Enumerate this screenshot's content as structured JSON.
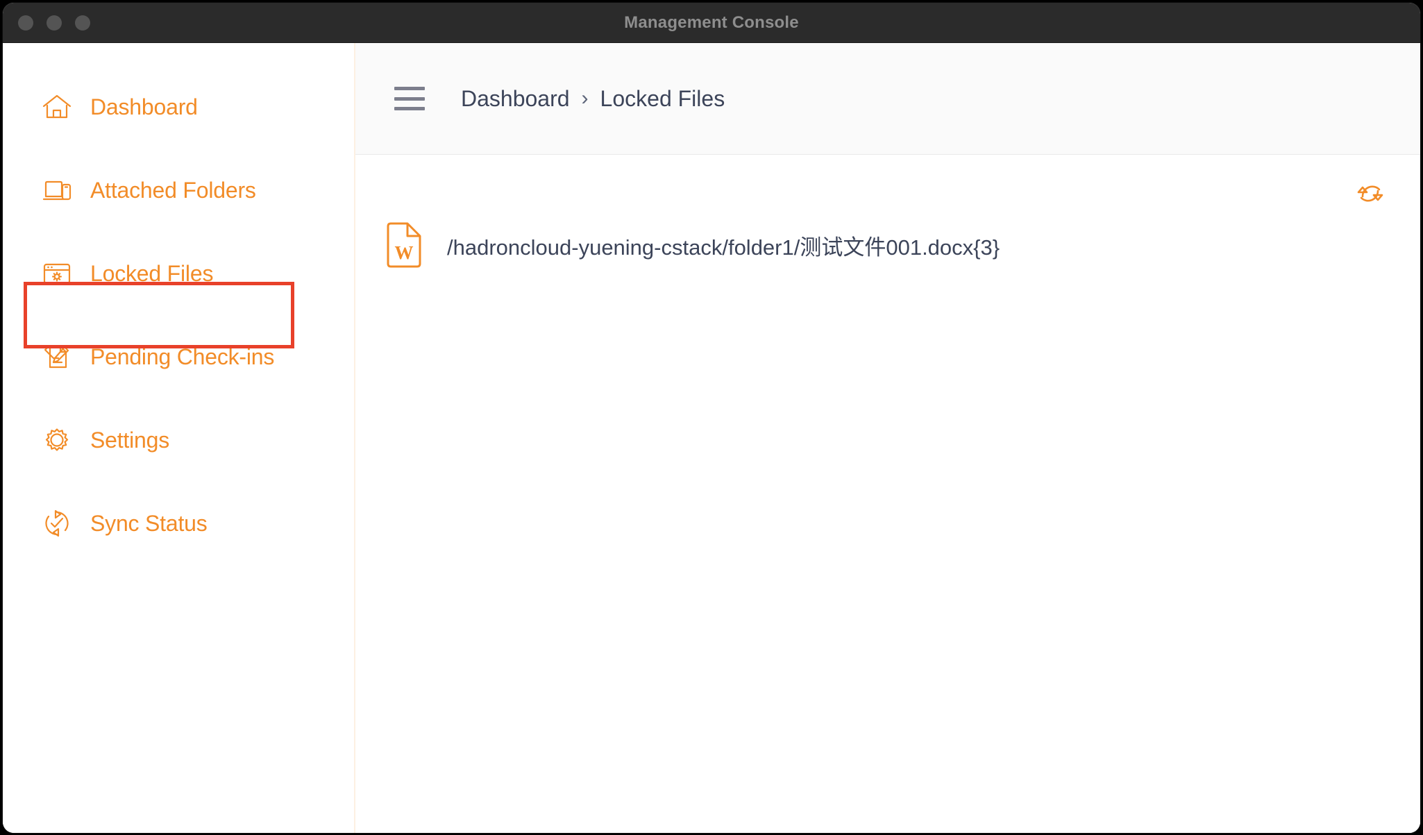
{
  "window": {
    "title": "Management Console",
    "traffic_lights": [
      "close",
      "minimize",
      "maximize"
    ]
  },
  "sidebar": {
    "items": [
      {
        "id": "dashboard",
        "label": "Dashboard",
        "icon": "home-icon",
        "active": false
      },
      {
        "id": "attached-folders",
        "label": "Attached Folders",
        "icon": "devices-icon",
        "active": false
      },
      {
        "id": "locked-files",
        "label": "Locked Files",
        "icon": "window-gear-icon",
        "active": true
      },
      {
        "id": "pending-checkins",
        "label": "Pending Check-ins",
        "icon": "document-pen-icon",
        "active": false
      },
      {
        "id": "settings",
        "label": "Settings",
        "icon": "gear-icon",
        "active": false
      },
      {
        "id": "sync-status",
        "label": "Sync Status",
        "icon": "sync-check-icon",
        "active": false
      }
    ]
  },
  "header": {
    "menu_icon": "hamburger-icon",
    "breadcrumb": {
      "root": "Dashboard",
      "separator": "›",
      "current": "Locked Files"
    }
  },
  "content": {
    "refresh_icon": "refresh-icon",
    "files": [
      {
        "icon": "word-document-icon",
        "icon_letter": "W",
        "path": "/hadroncloud-yuening-cstack/folder1/测试文件001.docx{3}"
      }
    ]
  },
  "colors": {
    "accent_orange": "#f28c28",
    "highlight_red": "#e8412a",
    "text_slate": "#3c4459",
    "titlebar_bg": "#2b2b2b",
    "titlebar_text": "#8e8e8e",
    "header_bg": "#fafafa",
    "sidebar_divider": "#fdf0e2",
    "hamburger_gray": "#7c7e8c"
  }
}
